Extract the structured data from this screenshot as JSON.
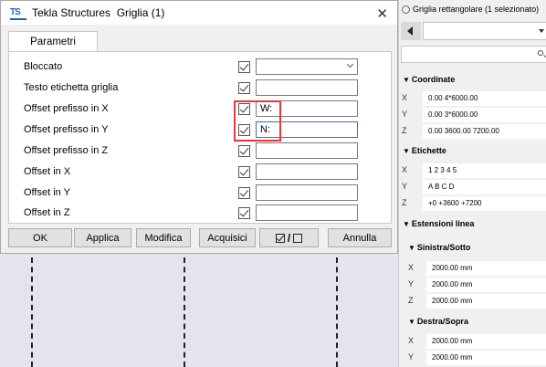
{
  "dialog": {
    "app_title": "Tekla Structures",
    "window_title": "Griglia (1)",
    "tab_label": "Parametri",
    "rows": [
      {
        "label": "Bloccato",
        "value": "",
        "dropdown": true
      },
      {
        "label": "Testo etichetta griglia",
        "value": ""
      },
      {
        "label": "Offset prefisso in X",
        "value": "W:"
      },
      {
        "label": "Offset prefisso in Y",
        "value": "N:"
      },
      {
        "label": "Offset prefisso in Z",
        "value": ""
      },
      {
        "label": "Offset in X",
        "value": ""
      },
      {
        "label": "Offset in Y",
        "value": ""
      },
      {
        "label": "Offset in Z",
        "value": ""
      }
    ],
    "buttons": {
      "ok": "OK",
      "apply": "Applica",
      "modify": "Modifica",
      "acquire": "Acquisici",
      "cancel": "Annulla"
    }
  },
  "properties": {
    "title": "Griglia rettangolare (1 selezionato)",
    "sections": {
      "coordinates": "Coordinate",
      "labels": "Etichette",
      "extensions": "Estensioni linea",
      "left_bottom": "Sinistra/Sotto",
      "right_top": "Destra/Sopra"
    },
    "coordinates": [
      {
        "key": "X",
        "value": "0.00 4*6000.00"
      },
      {
        "key": "Y",
        "value": "0.00 3*6000.00"
      },
      {
        "key": "Z",
        "value": "0.00 3600.00 7200.00"
      }
    ],
    "labels": [
      {
        "key": "X",
        "value": "1 2 3 4 5"
      },
      {
        "key": "Y",
        "value": "A B C D"
      },
      {
        "key": "Z",
        "value": "+0 +3600 +7200"
      }
    ],
    "left_bottom": [
      {
        "key": "X",
        "value": "2000.00 mm"
      },
      {
        "key": "Y",
        "value": "2000.00 mm"
      },
      {
        "key": "Z",
        "value": "2000.00 mm"
      }
    ],
    "right_top": [
      {
        "key": "X",
        "value": "2000.00 mm"
      },
      {
        "key": "Y",
        "value": "2000.00 mm"
      }
    ]
  },
  "icons": {
    "close": "close-icon",
    "logo": "tekla-logo-icon",
    "gear": "gear-icon",
    "back": "back-arrow-icon",
    "search": "search-icon"
  },
  "colors": {
    "highlight": "#e0393e",
    "accent": "#1f5fbf",
    "active_field": "#2f6fd6"
  }
}
